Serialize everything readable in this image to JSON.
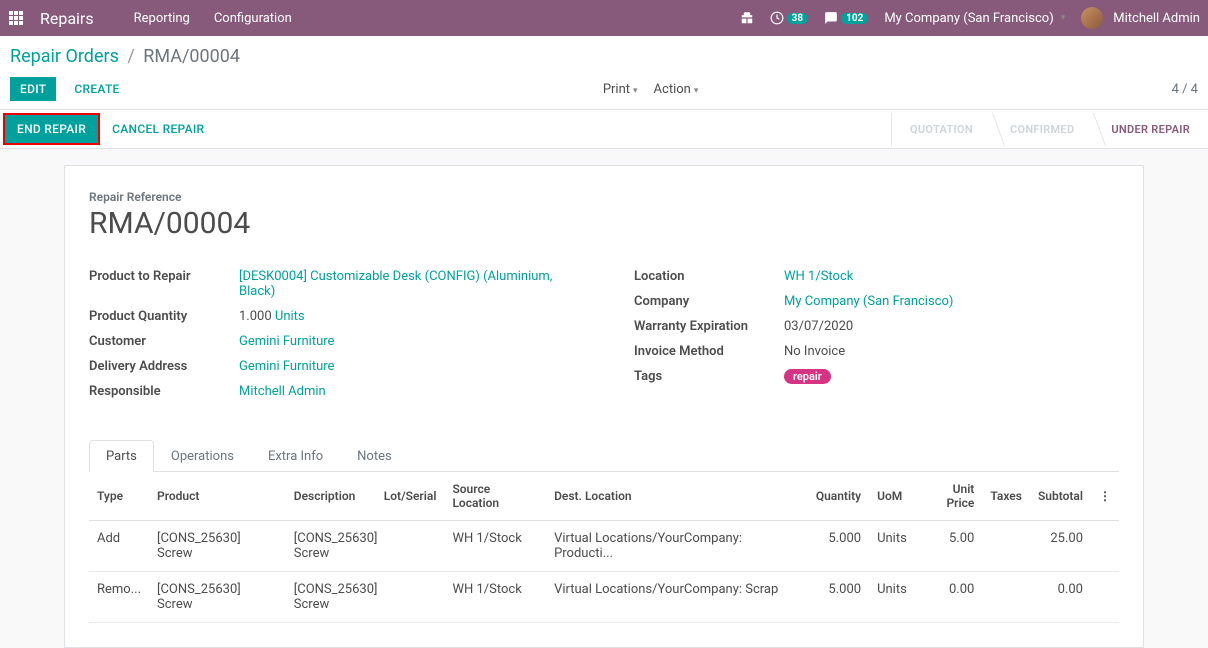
{
  "topbar": {
    "app_title": "Repairs",
    "menu": [
      "Reporting",
      "Configuration"
    ],
    "clock_badge": "38",
    "msg_badge": "102",
    "company": "My Company (San Francisco)",
    "user": "Mitchell Admin"
  },
  "breadcrumb": {
    "root": "Repair Orders",
    "current": "RMA/00004"
  },
  "buttons": {
    "edit": "EDIT",
    "create": "CREATE",
    "print": "Print",
    "action": "Action",
    "end_repair": "END REPAIR",
    "cancel_repair": "CANCEL REPAIR"
  },
  "pager": "4 / 4",
  "stages": {
    "quotation": "QUOTATION",
    "confirmed": "CONFIRMED",
    "under_repair": "UNDER REPAIR"
  },
  "record": {
    "ref_label": "Repair Reference",
    "ref_value": "RMA/00004",
    "product_to_repair_label": "Product to Repair",
    "product_to_repair": "[DESK0004] Customizable Desk (CONFIG) (Aluminium, Black)",
    "product_qty_label": "Product Quantity",
    "product_qty": "1.000",
    "product_qty_uom": "Units",
    "customer_label": "Customer",
    "customer": "Gemini Furniture",
    "delivery_label": "Delivery Address",
    "delivery": "Gemini Furniture",
    "responsible_label": "Responsible",
    "responsible": "Mitchell Admin",
    "location_label": "Location",
    "location": "WH 1/Stock",
    "company_label": "Company",
    "company": "My Company (San Francisco)",
    "warranty_label": "Warranty Expiration",
    "warranty": "03/07/2020",
    "invoice_method_label": "Invoice Method",
    "invoice_method": "No Invoice",
    "tags_label": "Tags",
    "tag": "repair"
  },
  "tabs": {
    "parts": "Parts",
    "operations": "Operations",
    "extra": "Extra Info",
    "notes": "Notes"
  },
  "parts_table": {
    "headers": {
      "type": "Type",
      "product": "Product",
      "description": "Description",
      "lot": "Lot/Serial",
      "source": "Source Location",
      "dest": "Dest. Location",
      "qty": "Quantity",
      "uom": "UoM",
      "unit_price": "Unit Price",
      "taxes": "Taxes",
      "subtotal": "Subtotal"
    },
    "rows": [
      {
        "type": "Add",
        "product": "[CONS_25630] Screw",
        "desc": "[CONS_25630] Screw",
        "lot": "",
        "source": "WH 1/Stock",
        "dest": "Virtual Locations/YourCompany: Producti...",
        "qty": "5.000",
        "uom": "Units",
        "price": "5.00",
        "taxes": "",
        "subtotal": "25.00"
      },
      {
        "type": "Remo...",
        "product": "[CONS_25630] Screw",
        "desc": "[CONS_25630] Screw",
        "lot": "",
        "source": "WH 1/Stock",
        "dest": "Virtual Locations/YourCompany: Scrap",
        "qty": "5.000",
        "uom": "Units",
        "price": "0.00",
        "taxes": "",
        "subtotal": "0.00"
      }
    ]
  }
}
